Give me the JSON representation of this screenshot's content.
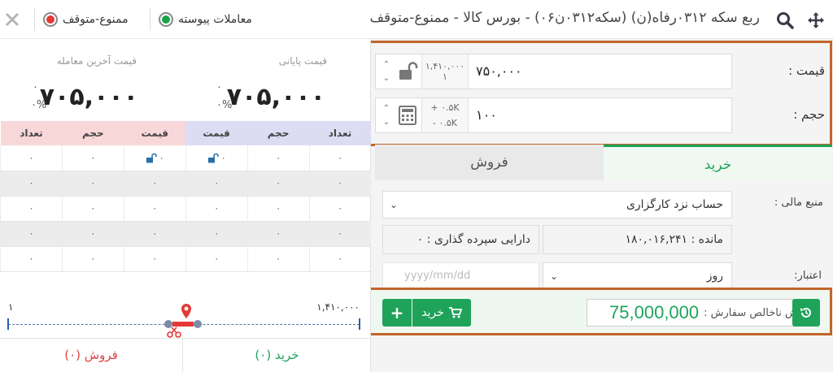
{
  "titlebar": {
    "title": "ربع سکه ۰۳۱۲رفاه(ن) (سکه۰۳۱۲ن۰۶) - بورس کالا - ممنوع-متوقف",
    "status_continuous": "معاملات پیوسته",
    "status_halted": "ممنوع-متوقف",
    "status_continuous_color": "#1aa34a",
    "status_halted_color": "#e53935"
  },
  "order": {
    "price_label": "قیمت :",
    "price_value": "۷۵۰,۰۰۰",
    "price_max": "۱,۴۱۰,۰۰۰",
    "price_min": "۱",
    "volume_label": "حجم :",
    "volume_value": "۱۰۰",
    "volume_plus": "+ ۰.۵K",
    "volume_minus": "- ۰.۵K",
    "tab_buy": "خرید",
    "tab_sell": "فروش",
    "source_label": "منبع مالی :",
    "source_value": "حساب نزد کارگزاری",
    "remaining": "مانده : ۱۸۰,۰۱۶,۲۴۱",
    "deposit": "دارایی سپرده گذاری : ۰",
    "validity_label": "اعتبار:",
    "validity_value": "روز",
    "date_placeholder": "yyyy/mm/dd",
    "gross_label": "ارزش ناخالص سفارش :",
    "gross_value": "75,000,000",
    "buy_button": "خرید",
    "add_button": "+"
  },
  "market": {
    "final_price_caption": "قیمت پایانی",
    "final_price": "۷۰۵,۰۰۰",
    "final_change": "۰",
    "final_pct": "۰%",
    "last_price_caption": "قیمت آخرین معامله",
    "last_price": "۷۰۵,۰۰۰",
    "last_change": "۰",
    "last_pct": "۰%",
    "headers": [
      "تعداد",
      "حجم",
      "قیمت",
      "قیمت",
      "حجم",
      "تعداد"
    ],
    "rows": [
      [
        "۰",
        "۰",
        "۰",
        "۰",
        "۰",
        "۰"
      ],
      [
        "۰",
        "۰",
        "۰",
        "۰",
        "۰",
        "۰"
      ],
      [
        "۰",
        "۰",
        "۰",
        "۰",
        "۰",
        "۰"
      ],
      [
        "۰",
        "۰",
        "۰",
        "۰",
        "۰",
        "۰"
      ],
      [
        "۰",
        "۰",
        "۰",
        "۰",
        "۰",
        "۰"
      ]
    ],
    "range_max": "۱,۴۱۰,۰۰۰",
    "range_min": "۱",
    "buy_count": "خرید (۰)",
    "sell_count": "فروش (۰)"
  }
}
